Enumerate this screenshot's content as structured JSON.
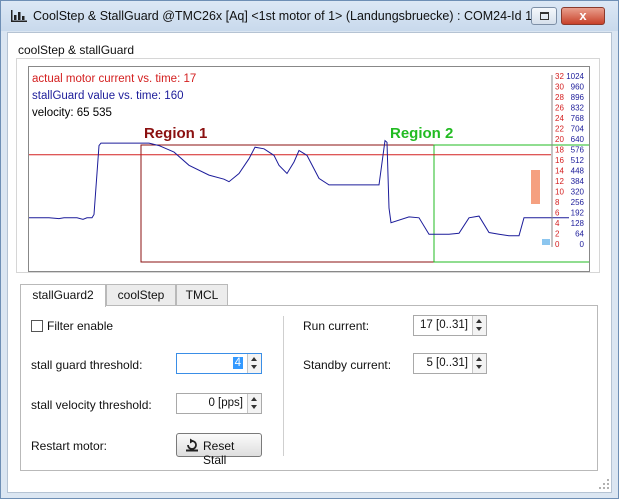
{
  "window": {
    "title": "CoolStep & StallGuard @TMC26x [Aq] <1st motor of 1> (Landungsbruecke) : COM24-Id 1",
    "close_symbol": "x"
  },
  "group": {
    "title": "coolStep & stallGuard"
  },
  "chart": {
    "legend_current": "actual motor current vs. time: 17",
    "legend_stallguard": "stallGuard value vs. time: 160",
    "legend_velocity": "velocity: 65 535",
    "region1_label": "Region 1",
    "region2_label": "Region 2",
    "colors": {
      "current": "#d42020",
      "stallguard": "#1c1c9a",
      "velocity": "#000000",
      "region1": "#8b1010",
      "region2": "#22bb22",
      "bar": "#f5a080",
      "bar_small": "#8cc6ef"
    }
  },
  "chart_data": {
    "type": "line",
    "series": [
      {
        "name": "actual motor current vs. time",
        "axis": "left",
        "values": [
          17
        ]
      },
      {
        "name": "stallGuard value vs. time",
        "axis": "right",
        "points": [
          [
            0,
            160
          ],
          [
            20,
            160
          ],
          [
            30,
            155
          ],
          [
            35,
            160
          ],
          [
            48,
            160
          ],
          [
            54,
            150
          ],
          [
            58,
            160
          ],
          [
            63,
            160
          ],
          [
            65,
            180
          ],
          [
            70,
            600
          ],
          [
            72,
            615
          ],
          [
            120,
            615
          ],
          [
            130,
            600
          ],
          [
            145,
            560
          ],
          [
            160,
            480
          ],
          [
            180,
            420
          ],
          [
            195,
            395
          ],
          [
            200,
            380
          ],
          [
            210,
            430
          ],
          [
            220,
            520
          ],
          [
            226,
            590
          ],
          [
            235,
            580
          ],
          [
            245,
            540
          ],
          [
            250,
            480
          ],
          [
            258,
            430
          ],
          [
            265,
            500
          ],
          [
            270,
            570
          ],
          [
            278,
            540
          ],
          [
            290,
            400
          ],
          [
            300,
            360
          ],
          [
            320,
            360
          ],
          [
            340,
            360
          ],
          [
            350,
            360
          ],
          [
            356,
            630
          ],
          [
            358,
            620
          ],
          [
            360,
            220
          ],
          [
            362,
            130
          ],
          [
            380,
            165
          ],
          [
            390,
            160
          ],
          [
            400,
            60
          ],
          [
            420,
            60
          ],
          [
            430,
            65
          ],
          [
            440,
            160
          ],
          [
            450,
            170
          ],
          [
            460,
            70
          ],
          [
            470,
            60
          ],
          [
            480,
            50
          ],
          [
            490,
            50
          ],
          [
            495,
            160
          ],
          [
            520,
            160
          ],
          [
            540,
            160
          ]
        ]
      }
    ],
    "y_axis_left": {
      "color": "#d42020",
      "ticks": [
        "32",
        "30",
        "28",
        "26",
        "24",
        "22",
        "20",
        "18",
        "16",
        "14",
        "12",
        "10",
        "8",
        "6",
        "4",
        "2",
        "0"
      ]
    },
    "y_axis_right": {
      "color": "#1c1c9a",
      "ticks": [
        "1024",
        "960",
        "896",
        "832",
        "768",
        "704",
        "640",
        "576",
        "512",
        "448",
        "384",
        "320",
        "256",
        "192",
        "128",
        "64",
        "0"
      ]
    },
    "ylim_left": [
      0,
      32
    ],
    "ylim_right": [
      0,
      1024
    ],
    "regions": [
      {
        "name": "Region 1",
        "x_from": 65,
        "x_to": 358
      },
      {
        "name": "Region 2",
        "x_from": 358,
        "x_to": 525
      }
    ],
    "grid": false
  },
  "tabs": [
    {
      "label": "stallGuard2",
      "active": true
    },
    {
      "label": "coolStep",
      "active": false
    },
    {
      "label": "TMCL",
      "active": false
    }
  ],
  "form": {
    "filter_enable_label": "Filter enable",
    "filter_enable_checked": false,
    "stall_threshold_label": "stall guard threshold:",
    "stall_threshold_value": "4",
    "stall_velocity_label": "stall velocity threshold:",
    "stall_velocity_value": "0 [pps]",
    "restart_label": "Restart motor:",
    "reset_button_label": "Reset Stall",
    "run_current_label": "Run current:",
    "run_current_value": "17 [0..31]",
    "standby_current_label": "Standby current:",
    "standby_current_value": "5 [0..31]"
  }
}
